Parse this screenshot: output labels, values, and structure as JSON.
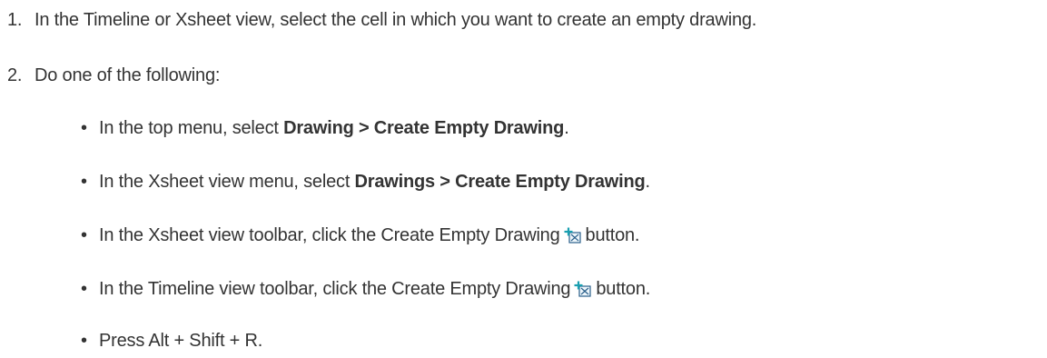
{
  "steps": [
    {
      "number": "1.",
      "text": "In the Timeline or Xsheet view, select the cell in which you want to create an empty drawing."
    },
    {
      "number": "2.",
      "text": "Do one of the following:"
    }
  ],
  "bullets": [
    {
      "prefix": "In the top menu, select ",
      "bold": "Drawing > Create Empty Drawing",
      "suffix": "."
    },
    {
      "prefix": "In the Xsheet view menu, select ",
      "bold": "Drawings > Create Empty Drawing",
      "suffix": "."
    },
    {
      "prefix": "In the Xsheet view toolbar, click the Create Empty Drawing",
      "icon": "create-empty-drawing-icon",
      "suffix": "button."
    },
    {
      "prefix": "In the Timeline view toolbar, click the Create Empty Drawing",
      "icon": "create-empty-drawing-icon",
      "suffix": "button."
    },
    {
      "prefix": "Press Alt + Shift + R."
    }
  ],
  "bullet_char": "•",
  "colors": {
    "text": "#333333",
    "icon_plus": "#1a9fb0",
    "icon_box": "#2a5f8a"
  }
}
